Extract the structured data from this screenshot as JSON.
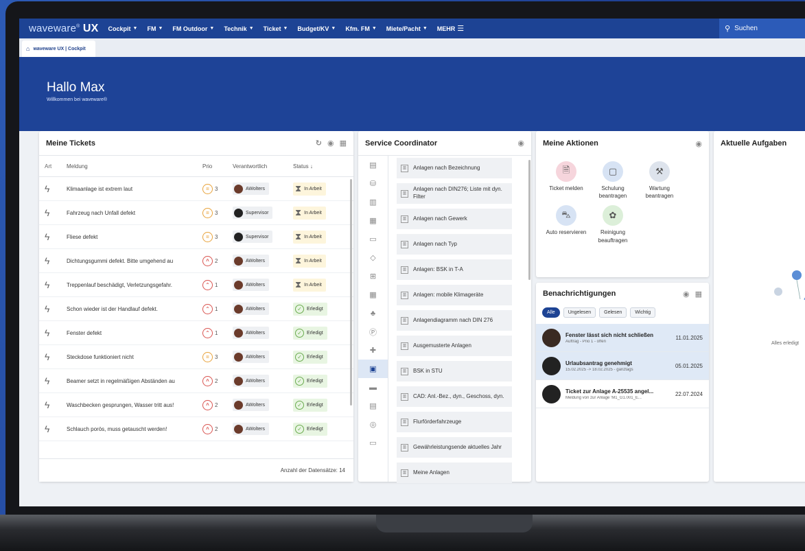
{
  "nav": {
    "logo_light": "waveware",
    "logo_mark": "®",
    "logo_bold": "UX",
    "items": [
      "Cockpit",
      "FM",
      "FM Outdoor",
      "Technik",
      "Ticket",
      "Budget/KV",
      "Kfm. FM",
      "Miete/Pacht"
    ],
    "more": "MEHR",
    "search": "Suchen"
  },
  "tab": {
    "label": "waveware UX | Cockpit"
  },
  "hero": {
    "title": "Hallo Max",
    "subtitle": "Willkommen bei waveware®"
  },
  "tickets": {
    "title": "Meine Tickets",
    "columns": {
      "art": "Art",
      "meldung": "Meldung",
      "prio": "Prio",
      "verantwortlich": "Verantwortlich",
      "status": "Status"
    },
    "rows": [
      {
        "msg": "Klimaanlage ist extrem laut",
        "prio": "3",
        "resp": "AWolters",
        "status": "In Arbeit"
      },
      {
        "msg": "Fahrzeug nach Unfall defekt",
        "prio": "3",
        "resp": "Supervisor",
        "status": "In Arbeit"
      },
      {
        "msg": "Fliese defekt",
        "prio": "3",
        "resp": "Supervisor",
        "status": "In Arbeit"
      },
      {
        "msg": "Dichtungsgummi defekt. Bitte umgehend au",
        "prio": "2",
        "resp": "AWolters",
        "status": "In Arbeit"
      },
      {
        "msg": "Treppenlauf beschädigt, Verletzungsgefahr.",
        "prio": "1",
        "resp": "AWolters",
        "status": "In Arbeit"
      },
      {
        "msg": "Schon wieder ist der Handlauf defekt.",
        "prio": "1",
        "resp": "AWolters",
        "status": "Erledigt"
      },
      {
        "msg": "Fenster defekt",
        "prio": "1",
        "resp": "AWolters",
        "status": "Erledigt"
      },
      {
        "msg": "Steckdose funktioniert nicht",
        "prio": "3",
        "resp": "AWolters",
        "status": "Erledigt"
      },
      {
        "msg": "Beamer setzt in regelmäßigen Abständen au",
        "prio": "2",
        "resp": "AWolters",
        "status": "Erledigt"
      },
      {
        "msg": "Waschbecken gesprungen, Wasser tritt aus!",
        "prio": "2",
        "resp": "AWolters",
        "status": "Erledigt"
      },
      {
        "msg": "Schlauch porös, muss getauscht werden!",
        "prio": "2",
        "resp": "AWolters",
        "status": "Erledigt"
      }
    ],
    "footer": "Anzahl der Datensätze: 14"
  },
  "service": {
    "title": "Service Coordinator",
    "items": [
      "Anlagen nach Bezeichnung",
      "Anlagen nach DIN276; Liste mit dyn. Filter",
      "Anlagen nach Gewerk",
      "Anlagen nach Typ",
      "Anlagen: BSK in T-A",
      "Anlagen: mobile Klimageräte",
      "Anlagendiagramm nach DIN 276",
      "Ausgemusterte Anlagen",
      "BSK in STU",
      "CAD: Anl.-Bez., dyn., Geschoss, dyn.",
      "Flurförderfahrzeuge",
      "Gewährleistungsende aktuelles Jahr",
      "Meine Anlagen"
    ]
  },
  "aktionen": {
    "title": "Meine Aktionen",
    "items": [
      {
        "label": "Ticket melden",
        "color": "#f6d5dc"
      },
      {
        "label": "Schulung beantragen",
        "color": "#d7e3f4"
      },
      {
        "label": "Wartung beantragen",
        "color": "#dde3ec"
      },
      {
        "label": "Auto reservieren",
        "color": "#d7e3f4"
      },
      {
        "label": "Reinigung beauftragen",
        "color": "#dcefd9"
      }
    ]
  },
  "notif": {
    "title": "Benachrichtigungen",
    "chips": [
      "Alle",
      "Ungelesen",
      "Gelesen",
      "Wichtig"
    ],
    "rows": [
      {
        "t1": "Fenster lässt sich nicht schließen",
        "t2": "Auftrag - Prio 1 - offen",
        "date": "11.01.2025"
      },
      {
        "t1": "Urlaubsantrag genehmigt",
        "t2": "15.02.2025 -> 18.02.2025 - ganztags",
        "date": "05.01.2025"
      },
      {
        "t1": "Ticket zur Anlage A-25535 angel...",
        "t2": "Meldung von zur Anlage 'M1_G1.001_E...",
        "date": "22.07.2024"
      }
    ]
  },
  "aufgaben": {
    "title": "Aktuelle Aufgaben",
    "empty": "Alles erledigt"
  },
  "colors": {
    "nav": "#1d4394",
    "accent": "#2c5bb8",
    "prio_mid": "#e8a23a",
    "prio_high": "#d9534f"
  }
}
